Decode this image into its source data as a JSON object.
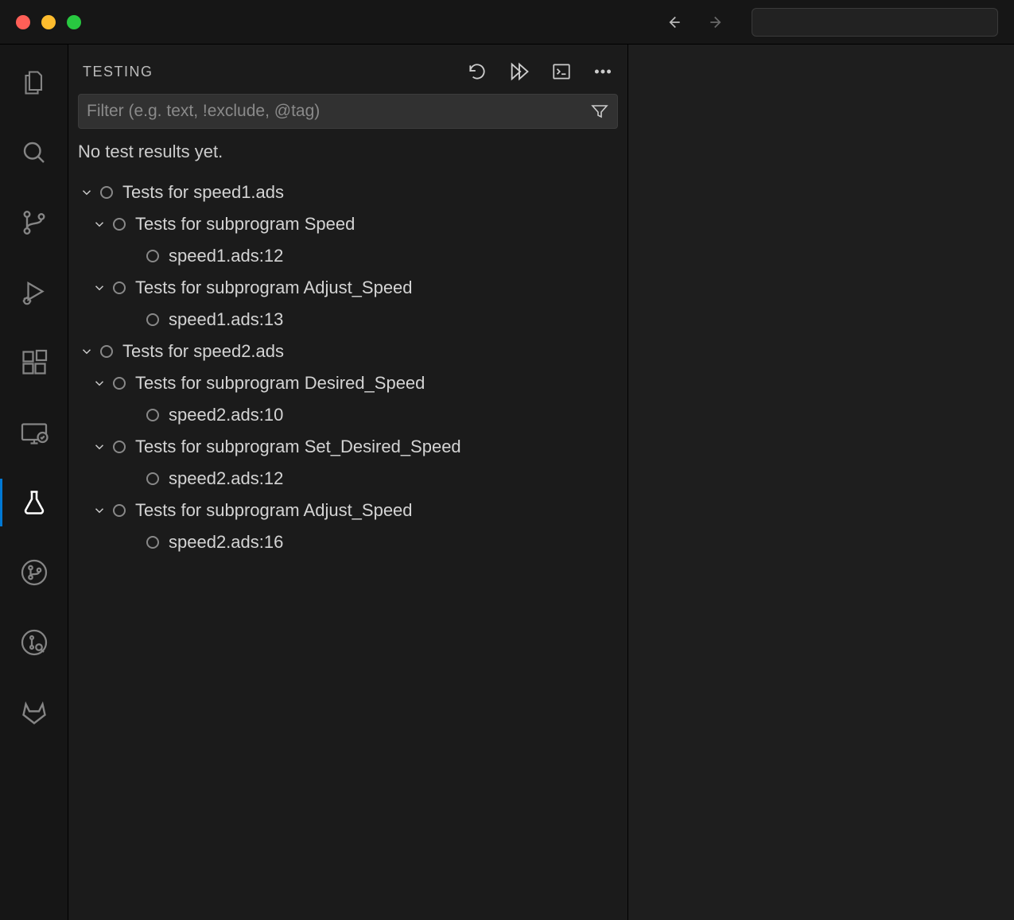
{
  "sidebar": {
    "title": "TESTING",
    "filter_placeholder": "Filter (e.g. text, !exclude, @tag)",
    "status": "No test results yet."
  },
  "tree": [
    {
      "label": "Tests for speed1.ads",
      "level": 0,
      "chevron": true
    },
    {
      "label": "Tests for subprogram Speed",
      "level": 1,
      "chevron": true
    },
    {
      "label": "speed1.ads:12",
      "level": 2,
      "chevron": false
    },
    {
      "label": "Tests for subprogram Adjust_Speed",
      "level": 1,
      "chevron": true
    },
    {
      "label": "speed1.ads:13",
      "level": 2,
      "chevron": false
    },
    {
      "label": "Tests for speed2.ads",
      "level": 0,
      "chevron": true
    },
    {
      "label": "Tests for subprogram Desired_Speed",
      "level": 1,
      "chevron": true
    },
    {
      "label": "speed2.ads:10",
      "level": 2,
      "chevron": false
    },
    {
      "label": "Tests for subprogram Set_Desired_Speed",
      "level": 1,
      "chevron": true
    },
    {
      "label": "speed2.ads:12",
      "level": 2,
      "chevron": false
    },
    {
      "label": "Tests for subprogram Adjust_Speed",
      "level": 1,
      "chevron": true
    },
    {
      "label": "speed2.ads:16",
      "level": 2,
      "chevron": false
    }
  ]
}
